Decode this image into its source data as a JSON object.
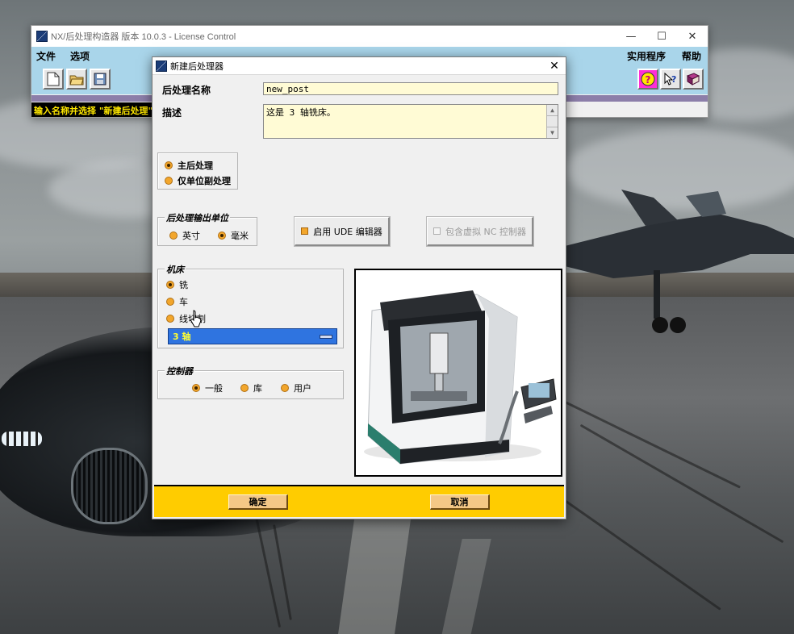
{
  "main_window": {
    "title": "NX/后处理构造器 版本 10.0.3 - License Control",
    "window_controls": [
      "—",
      "☐",
      "✕"
    ],
    "menu_left": [
      "文件",
      "选项"
    ],
    "menu_right": [
      "实用程序",
      "帮助"
    ],
    "toolbar_left_icons": [
      "new-file-icon",
      "open-folder-icon",
      "save-disk-icon"
    ],
    "toolbar_right_icons": [
      "help-question-icon",
      "whats-this-icon",
      "manual-book-icon"
    ],
    "status_text": "输入名称并选择 \"新建后处理\""
  },
  "dialog": {
    "title": "新建后处理器",
    "close": "✕",
    "post_name_label": "后处理名称",
    "post_name_value": "new_post",
    "description_label": "描述",
    "description_value": "这是 3 轴铣床。",
    "post_type_options": [
      "主后处理",
      "仅单位副处理"
    ],
    "units_group": {
      "title": "后处理输出单位",
      "options": [
        "英寸",
        "毫米"
      ],
      "selected": "毫米"
    },
    "vnc_editor_button": "启用 UDE 编辑器",
    "virtual_nc_button": "包含虚拟 NC 控制器",
    "machine_group": {
      "title": "机床",
      "options": [
        "铣",
        "车",
        "线切割"
      ],
      "selected": "铣",
      "axis_value": "3 轴"
    },
    "controller_group": {
      "title": "控制器",
      "options": [
        "一般",
        "库",
        "用户"
      ],
      "selected": "一般"
    },
    "ok_button": "确定",
    "cancel_button": "取消"
  },
  "colors": {
    "menubar": "#a9d5ea",
    "input_bg": "#fffbd5",
    "radio": "#f2a62c",
    "dropdown": "#2f74e0",
    "dropdown_text": "#ffff33",
    "footer": "#ffcc00"
  }
}
